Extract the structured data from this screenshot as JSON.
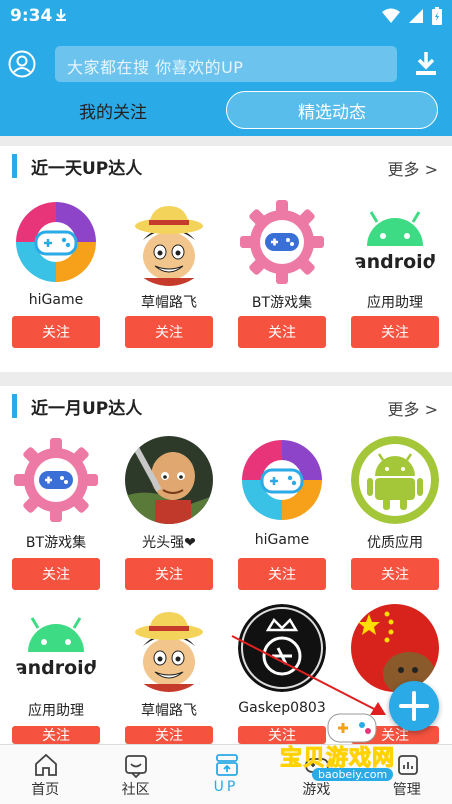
{
  "status": {
    "time": "9:34"
  },
  "search": {
    "placeholder": "大家都在搜 你喜欢的UP"
  },
  "tabs": {
    "follow": "我的关注",
    "featured": "精选动态"
  },
  "section_day": {
    "title": "近一天UP达人",
    "more": "更多 >",
    "cards": [
      {
        "name": "hiGame",
        "button": "关注"
      },
      {
        "name": "草帽路飞",
        "button": "关注"
      },
      {
        "name": "BT游戏集",
        "button": "关注"
      },
      {
        "name": "应用助理",
        "button": "关注"
      }
    ]
  },
  "section_month": {
    "title": "近一月UP达人",
    "more": "更多 >",
    "cards": [
      {
        "name": "BT游戏集",
        "button": "关注"
      },
      {
        "name": "光头强❤",
        "button": "关注"
      },
      {
        "name": "hiGame",
        "button": "关注"
      },
      {
        "name": "优质应用",
        "button": "关注"
      },
      {
        "name": "应用助理",
        "button": "关注"
      },
      {
        "name": "草帽路飞",
        "button": "关注"
      },
      {
        "name": "Gaskep0803",
        "button": "关注"
      },
      {
        "name": "",
        "button": "关注"
      }
    ]
  },
  "nav": {
    "home": "首页",
    "community": "社区",
    "up": "UP",
    "games": "游戏",
    "manage": "管理"
  },
  "watermark": {
    "text": "宝贝游戏网",
    "url": "baobeiy.com"
  },
  "colors": {
    "accent": "#2aaae6",
    "follow_button": "#f5523f"
  }
}
